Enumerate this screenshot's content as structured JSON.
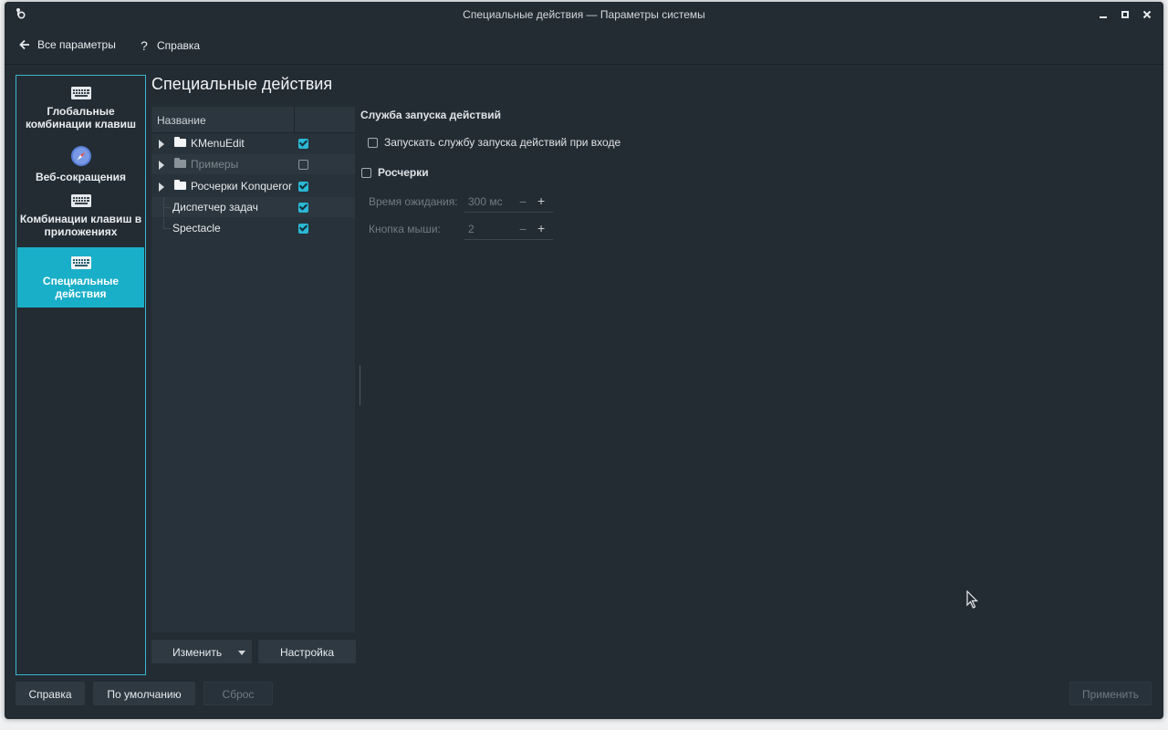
{
  "window": {
    "title": "Специальные действия — Параметры системы"
  },
  "toolbar": {
    "back_label": "Все параметры",
    "help_label": "Справка"
  },
  "sidebar": {
    "items": [
      {
        "label": "Глобальные комбинации клавиш",
        "icon": "keyboard-icon"
      },
      {
        "label": "Веб-сокращения",
        "icon": "compass-icon"
      },
      {
        "label": "Комбинации клавиш в приложениях",
        "icon": "keyboard-icon"
      },
      {
        "label": "Специальные действия",
        "icon": "keyboard-icon",
        "selected": true
      }
    ]
  },
  "page": {
    "title": "Специальные действия"
  },
  "tree": {
    "header": "Название",
    "rows": [
      {
        "name": "KMenuEdit",
        "folder": true,
        "checked": true
      },
      {
        "name": "Примеры",
        "folder": true,
        "checked": false,
        "disabled": true
      },
      {
        "name": "Росчерки Konqueror",
        "folder": true,
        "checked": true
      },
      {
        "name": "Диспетчер задач",
        "folder": false,
        "checked": true
      },
      {
        "name": "Spectacle",
        "folder": false,
        "checked": true
      }
    ],
    "edit_button": "Изменить",
    "settings_button": "Настройка"
  },
  "settings": {
    "service_title": "Служба запуска действий",
    "autostart_label": "Запускать службу запуска действий при входе",
    "gestures_label": "Росчерки",
    "timeout_label": "Время ожидания:",
    "timeout_value": "300 мс",
    "mouse_button_label": "Кнопка мыши:",
    "mouse_button_value": "2"
  },
  "footer": {
    "help_label": "Справка",
    "defaults_label": "По умолчанию",
    "reset_label": "Сброс",
    "apply_label": "Применить"
  },
  "colors": {
    "accent": "#1aafc8",
    "window_bg": "#232c33",
    "check": "#2bb8d5"
  }
}
